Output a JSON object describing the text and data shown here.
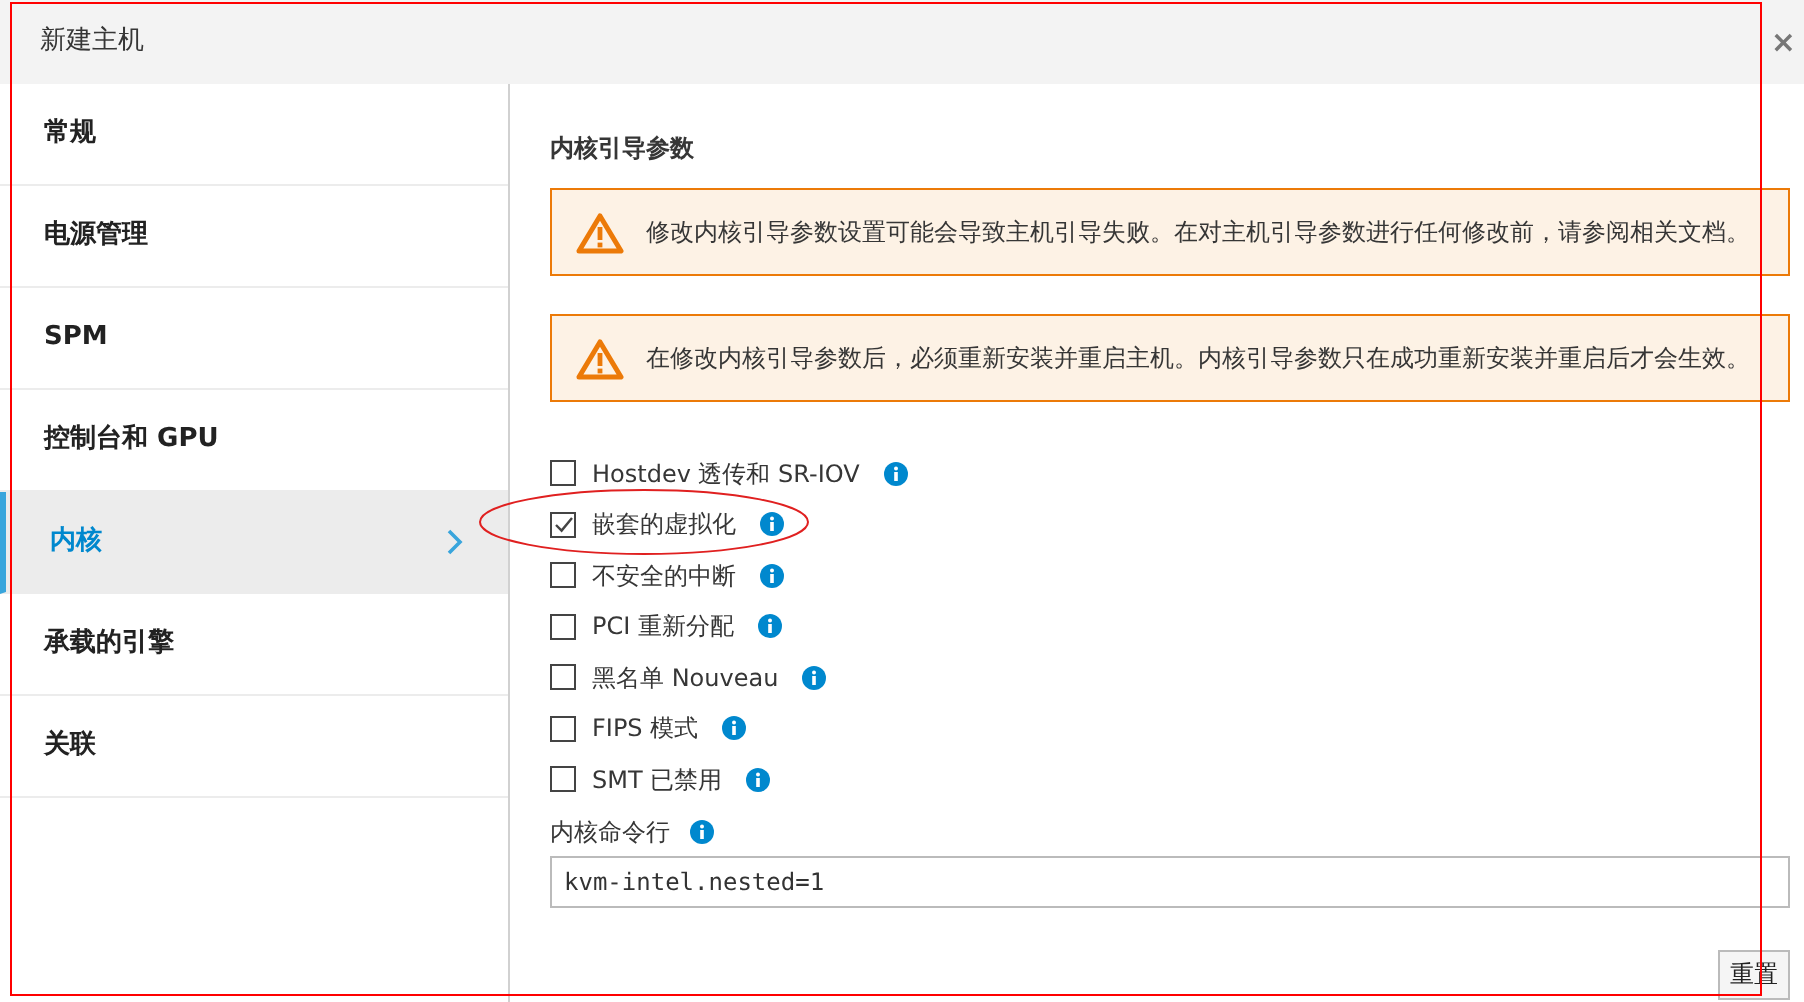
{
  "dialog": {
    "title": "新建主机",
    "close": "×"
  },
  "sidebar": {
    "items": [
      {
        "label": "常规",
        "selected": false
      },
      {
        "label": "电源管理",
        "selected": false
      },
      {
        "label": "SPM",
        "selected": false
      },
      {
        "label": "控制台和 GPU",
        "selected": false
      },
      {
        "label": "内核",
        "selected": true
      },
      {
        "label": "承载的引擎",
        "selected": false
      },
      {
        "label": "关联",
        "selected": false
      }
    ]
  },
  "section_title": "内核引导参数",
  "alerts": [
    "修改内核引导参数设置可能会导致主机引导失败。在对主机引导参数进行任何修改前，请参阅相关文档。",
    "在修改内核引导参数后，必须重新安装并重启主机。内核引导参数只在成功重新安装并重启后才会生效。"
  ],
  "options": [
    {
      "label": "Hostdev 透传和 SR-IOV",
      "checked": false
    },
    {
      "label": "嵌套的虚拟化",
      "checked": true
    },
    {
      "label": "不安全的中断",
      "checked": false
    },
    {
      "label": "PCI 重新分配",
      "checked": false
    },
    {
      "label": "黑名单 Nouveau",
      "checked": false
    },
    {
      "label": "FIPS 模式",
      "checked": false
    },
    {
      "label": "SMT 已禁用",
      "checked": false
    }
  ],
  "command_line": {
    "label": "内核命令行",
    "value": "kvm-intel.nested=1"
  },
  "reset_button": "重置"
}
